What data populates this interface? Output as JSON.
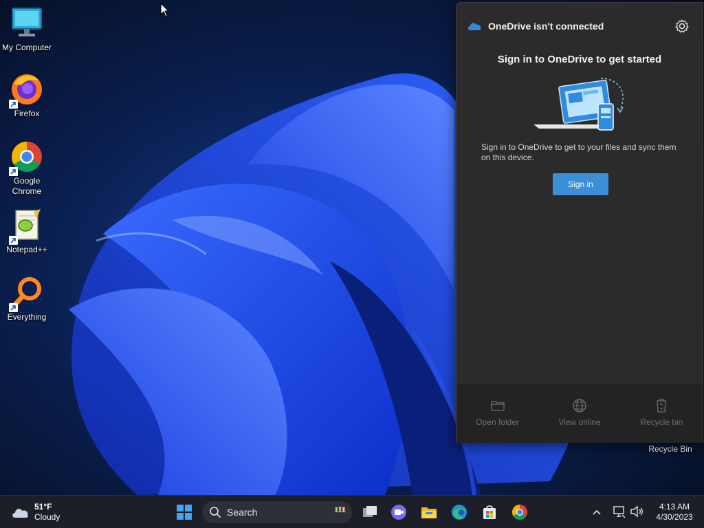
{
  "desktop": {
    "icons": [
      {
        "label": "My Computer"
      },
      {
        "label": "Firefox"
      },
      {
        "label_line1": "Google",
        "label_line2": "Chrome"
      },
      {
        "label": "Notepad++"
      },
      {
        "label": "Everything"
      }
    ],
    "recycle_bin_label": "Recycle Bin"
  },
  "onedrive": {
    "title": "OneDrive isn't connected",
    "heading": "Sign in to OneDrive to get started",
    "description": "Sign in to OneDrive to get to your files and sync them on this device.",
    "sign_in_label": "Sign in",
    "actions": [
      {
        "label": "Open folder",
        "icon": "folder-icon"
      },
      {
        "label": "View online",
        "icon": "globe-icon"
      },
      {
        "label": "Recycle bin",
        "icon": "recycle-bin-icon"
      }
    ],
    "accent_color": "#3a8fd8"
  },
  "taskbar": {
    "weather": {
      "temp": "51°F",
      "condition": "Cloudy"
    },
    "search_label": "Search",
    "clock": {
      "time": "4:13 AM",
      "date": "4/30/2023"
    }
  }
}
